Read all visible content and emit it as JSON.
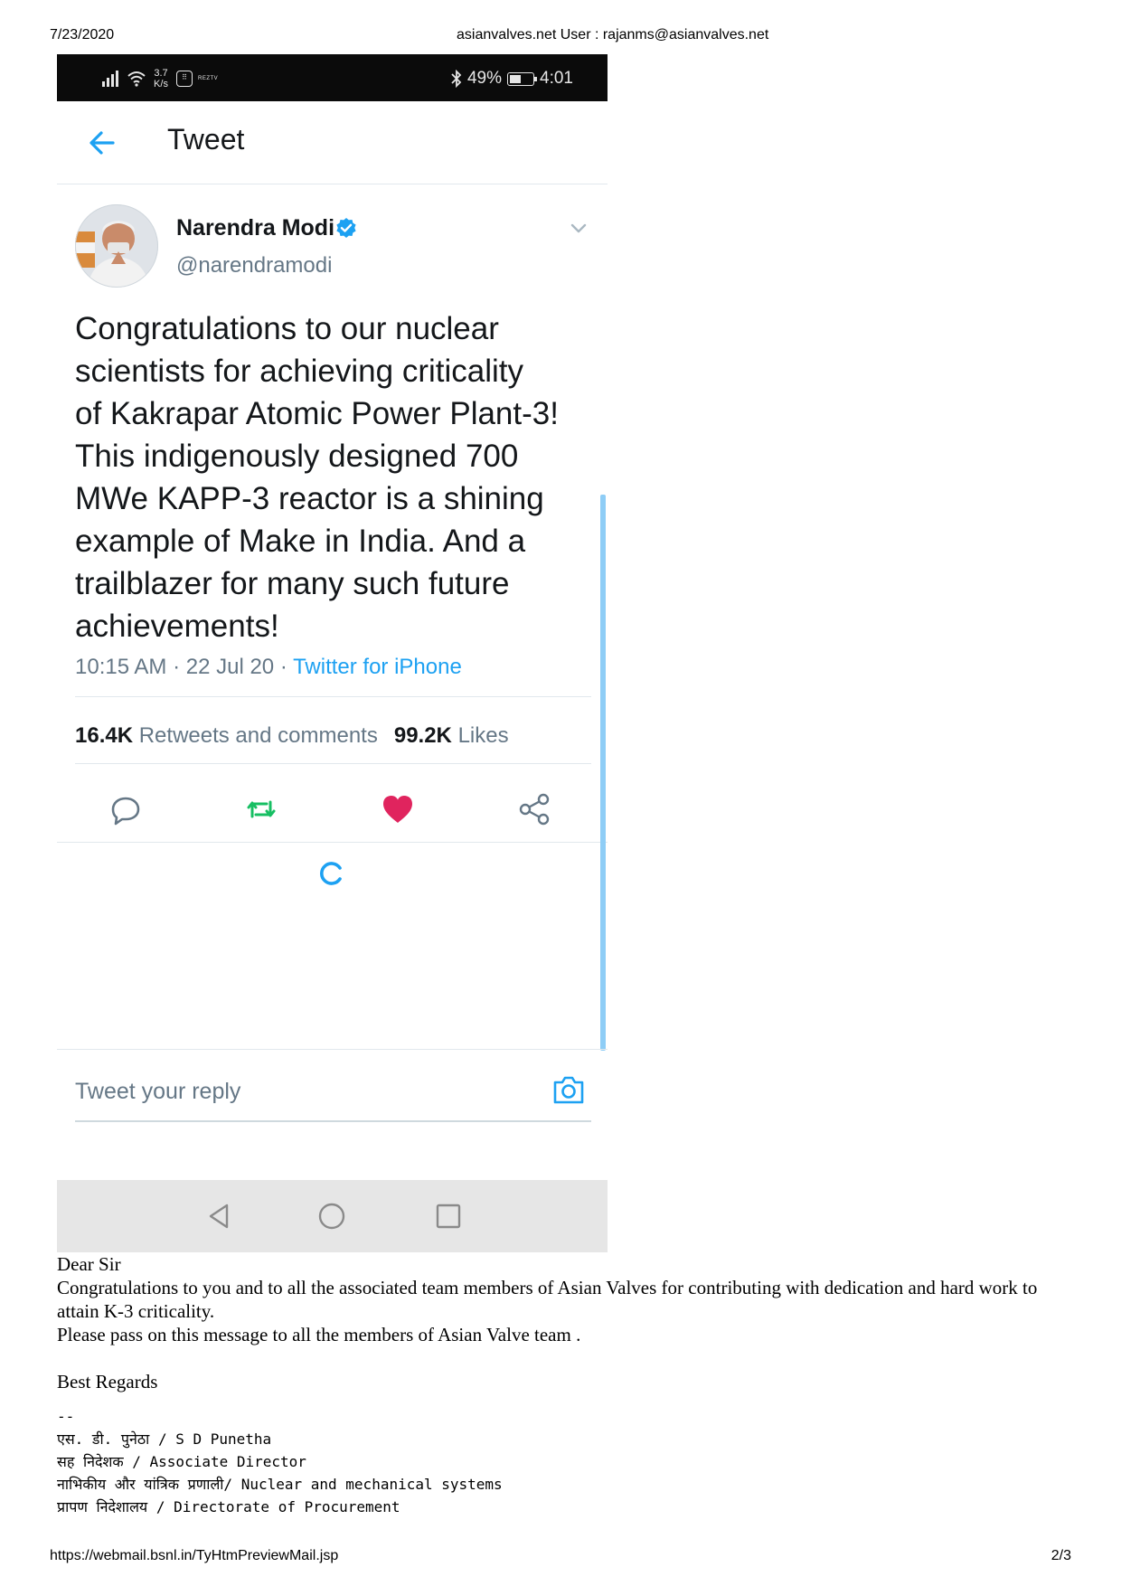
{
  "print": {
    "date": "7/23/2020",
    "title": "asianvalves.net User : rajanms@asianvalves.net",
    "url": "https://webmail.bsnl.in/TyHtmPreviewMail.jsp",
    "page": "2/3"
  },
  "statusbar": {
    "speed": "3.7\nK/s",
    "app_mini": "REZTV",
    "battery_text": "49%",
    "battery_level": 0.49,
    "time": "4:01"
  },
  "header": {
    "title": "Tweet"
  },
  "tweet": {
    "author_name": "Narendra Modi",
    "handle": "@narendramodi",
    "text": "Congratulations to our nuclear\nscientists for achieving criticality\nof Kakrapar Atomic Power Plant-3!\nThis indigenously designed 700\nMWe KAPP-3 reactor is a shining\nexample of Make in India. And a\ntrailblazer for many such future\nachievements!",
    "time": "10:15 AM",
    "date": "22 Jul 20",
    "source": "Twitter for iPhone",
    "retweets_count": "16.4K",
    "retweets_label": "Retweets and comments",
    "likes_count": "99.2K",
    "likes_label": "Likes"
  },
  "reply": {
    "placeholder": "Tweet your reply"
  },
  "colors": {
    "twitter_blue": "#1da1f2",
    "retweet_green": "#17bf63",
    "like_red": "#e0245e",
    "text_dark": "#14171a",
    "text_gray": "#657786"
  },
  "email": {
    "greeting": "Dear Sir",
    "para1": "Congratulations to you and to all the associated team members of  Asian Valves for contributing with dedication and hard work to attain K-3 criticality.",
    "para2": "Please pass on this message to all the members of Asian Valve team .",
    "closing": "Best Regards",
    "signature": [
      "--",
      "एस. डी. पुनेठा / S D Punetha",
      "सह निदेशक / Associate Director",
      "नाभिकीय और यांत्रिक प्रणाली/ Nuclear and mechanical systems",
      "प्रापण निदेशालय / Directorate of Procurement"
    ]
  }
}
